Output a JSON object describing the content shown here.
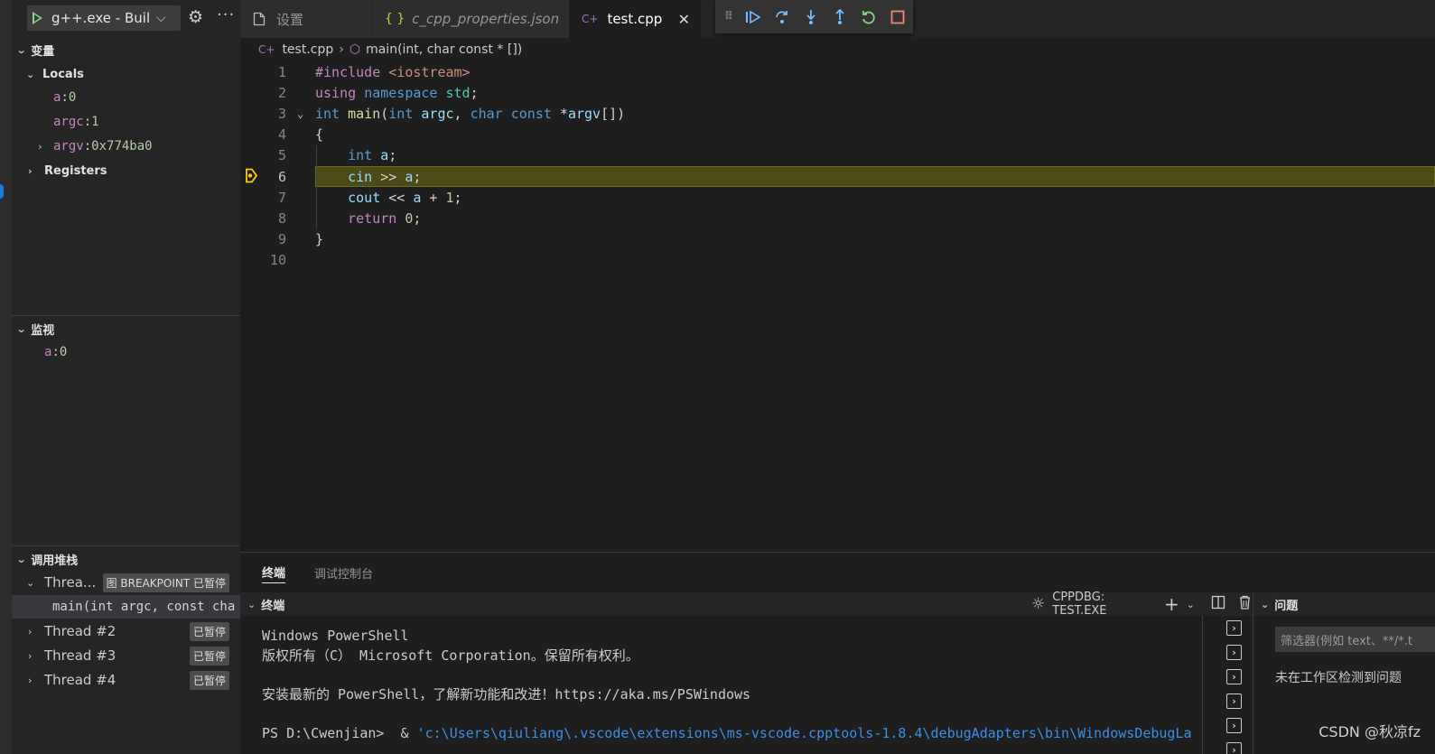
{
  "run_config": {
    "label": "g++.exe - Buil"
  },
  "tabs": [
    {
      "label": "设置",
      "icon": "file-icon"
    },
    {
      "label": "c_cpp_properties.json",
      "icon": "json-braces-icon"
    },
    {
      "label": "test.cpp",
      "icon": "cpp-icon"
    }
  ],
  "breadcrumb": {
    "file": "test.cpp",
    "symbol": "main(int, char const * [])"
  },
  "variables": {
    "title": "变量",
    "locals_label": "Locals",
    "items": [
      {
        "name": "a",
        "value": "0"
      },
      {
        "name": "argc",
        "value": "1"
      },
      {
        "name": "argv",
        "value": "0x774ba0"
      }
    ],
    "registers_label": "Registers"
  },
  "watch": {
    "title": "监视",
    "items": [
      {
        "name": "a",
        "value": "0"
      }
    ]
  },
  "callstack": {
    "title": "调用堆栈",
    "threads": [
      {
        "label": "Threa...",
        "badge": "图 BREAKPOINT 已暂停",
        "frame": "main(int argc, const cha"
      },
      {
        "label": "Thread #2",
        "badge": "已暂停"
      },
      {
        "label": "Thread #3",
        "badge": "已暂停"
      },
      {
        "label": "Thread #4",
        "badge": "已暂停"
      }
    ]
  },
  "code": {
    "line_numbers": [
      "1",
      "2",
      "3",
      "4",
      "5",
      "6",
      "7",
      "8",
      "9",
      "10"
    ],
    "current_line": "6"
  },
  "panel": {
    "tabs": [
      "终端",
      "调试控制台"
    ],
    "terminal_title": "终端",
    "terminal_instance": "CPPDBG: TEST.EXE",
    "terminal_lines": [
      "Windows PowerShell",
      "版权所有（C） Microsoft Corporation。保留所有权利。",
      "",
      "安装最新的 PowerShell，了解新功能和改进！https://aka.ms/PSWindows",
      ""
    ],
    "prompt": "PS D:\\Cwenjian>  & ",
    "prompt_path": "'c:\\Users\\qiuliang\\.vscode\\extensions\\ms-vscode.cpptools-1.8.4\\debugAdapters\\bin\\WindowsDebugLa",
    "problems_title": "问题",
    "problems_filter_placeholder": "筛选器(例如 text、**/*.t",
    "problems_message": "未在工作区检测到问题"
  },
  "watermark": "CSDN @秋凉fz",
  "colors": {
    "highlight_line": "#4b4b18",
    "keyword": "#569cd6",
    "string": "#ce9178",
    "accent_play": "#89d185"
  }
}
